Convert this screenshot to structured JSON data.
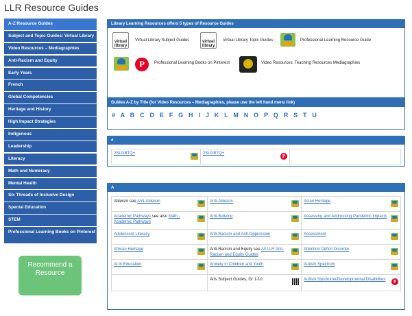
{
  "page_title": "LLR Resource Guides",
  "sidebar": {
    "items": [
      {
        "label": "A-Z Resource Guides"
      },
      {
        "label": "Subject and Topic Guides: Virtual Library"
      },
      {
        "label": "Video Resources – Mediagraphies"
      },
      {
        "label": "Anti-Racism and Equity"
      },
      {
        "label": "Early Years"
      },
      {
        "label": "French"
      },
      {
        "label": "Global Competencies"
      },
      {
        "label": "Heritage and History"
      },
      {
        "label": "High Impact Strategies"
      },
      {
        "label": "Indigenous"
      },
      {
        "label": "Leadership"
      },
      {
        "label": "Literacy"
      },
      {
        "label": "Math and Numeracy"
      },
      {
        "label": "Mental Health"
      },
      {
        "label": "Six Threads of Inclusive Design"
      },
      {
        "label": "Special Education"
      },
      {
        "label": "STEM"
      },
      {
        "label": "Professional Learning Books on Pinterest"
      }
    ],
    "recommend_button": "Recommend a Resource"
  },
  "types_panel": {
    "header": "Library Learning Resources offers 5 types of Resource Guides",
    "icon_text": {
      "virtual": "virtual library",
      "pinterest": "P"
    },
    "types": [
      {
        "label": "Virtual Library Subject Guides"
      },
      {
        "label": "Virtual Library Topic Guides"
      },
      {
        "label": "Professional Learning Resource Guide"
      },
      {
        "label": "Professional Learning Books on Pinterest"
      },
      {
        "label": "Video Resources: Teaching Resources Mediagraphies"
      }
    ]
  },
  "az_panel": {
    "header": "Guides A-Z by Title (for Video Resources – Mediagraphies, please use the left hand menu link)",
    "letters": "# A B C D E F G H I J K L M N O P Q R S T U"
  },
  "hash_panel": {
    "header": "#",
    "rows": [
      [
        "2SLGBTQ+",
        "2SLGBTQ+"
      ]
    ]
  },
  "a_panel": {
    "header": "A",
    "rows": [
      [
        {
          "parts": [
            {
              "t": "Ableism",
              "link": false
            },
            {
              "t": " see ",
              "link": false
            },
            {
              "t": "Anti-Ableism",
              "link": true
            }
          ],
          "icon": "owl"
        },
        {
          "parts": [
            {
              "t": "Anti-Ableism",
              "link": true
            }
          ],
          "icon": "owl"
        },
        {
          "parts": [
            {
              "t": "Asian Heritage",
              "link": true
            }
          ],
          "icon": "owl"
        }
      ],
      [
        {
          "parts": [
            {
              "t": "Academic Pathways",
              "link": true
            },
            {
              "t": " see also ",
              "link": false
            },
            {
              "t": "Math - Academic Pathways",
              "link": true
            }
          ],
          "icon": "owl"
        },
        {
          "parts": [
            {
              "t": "Anti-Bullying",
              "link": true
            }
          ],
          "icon": "owl"
        },
        {
          "parts": [
            {
              "t": "Assessing and Addressing Pandemic Impacts",
              "link": true
            }
          ],
          "icon": "owl"
        }
      ],
      [
        {
          "parts": [
            {
              "t": "Adolescent Literacy",
              "link": true
            }
          ],
          "icon": "owl"
        },
        {
          "parts": [
            {
              "t": "Anti-Racism and Anti-Oppression",
              "link": true
            }
          ],
          "icon": "owl"
        },
        {
          "parts": [
            {
              "t": "Assessment",
              "link": true
            }
          ],
          "icon": "owl"
        }
      ],
      [
        {
          "parts": [
            {
              "t": "African Heritage",
              "link": true
            }
          ],
          "icon": "owl"
        },
        {
          "parts": [
            {
              "t": "Anti-Racism and Equity",
              "link": false
            },
            {
              "t": " see ",
              "link": false
            },
            {
              "t": "All LLR Anti-Racism and Equity Guides",
              "link": true
            }
          ],
          "icon": "owl"
        },
        {
          "parts": [
            {
              "t": "Attention Deficit Disorder",
              "link": true
            }
          ],
          "icon": "owl"
        }
      ],
      [
        {
          "parts": [
            {
              "t": "AI in Education",
              "link": true
            }
          ],
          "icon": "owl"
        },
        {
          "parts": [
            {
              "t": "Anxiety in Children and Youth",
              "link": true
            }
          ],
          "icon": "owl"
        },
        {
          "parts": [
            {
              "t": "Autism Spectrum",
              "link": true
            }
          ],
          "icon": "owl"
        }
      ],
      [
        {
          "parts": [],
          "icon": "none"
        },
        {
          "parts": [
            {
              "t": "Arts Subject Guides, Gr 1-10",
              "link": false
            }
          ],
          "icon": "qr"
        },
        {
          "parts": [
            {
              "t": "Autism Syndrome/Developmental Disabilities",
              "link": true
            }
          ],
          "icon": "pin"
        }
      ]
    ]
  }
}
